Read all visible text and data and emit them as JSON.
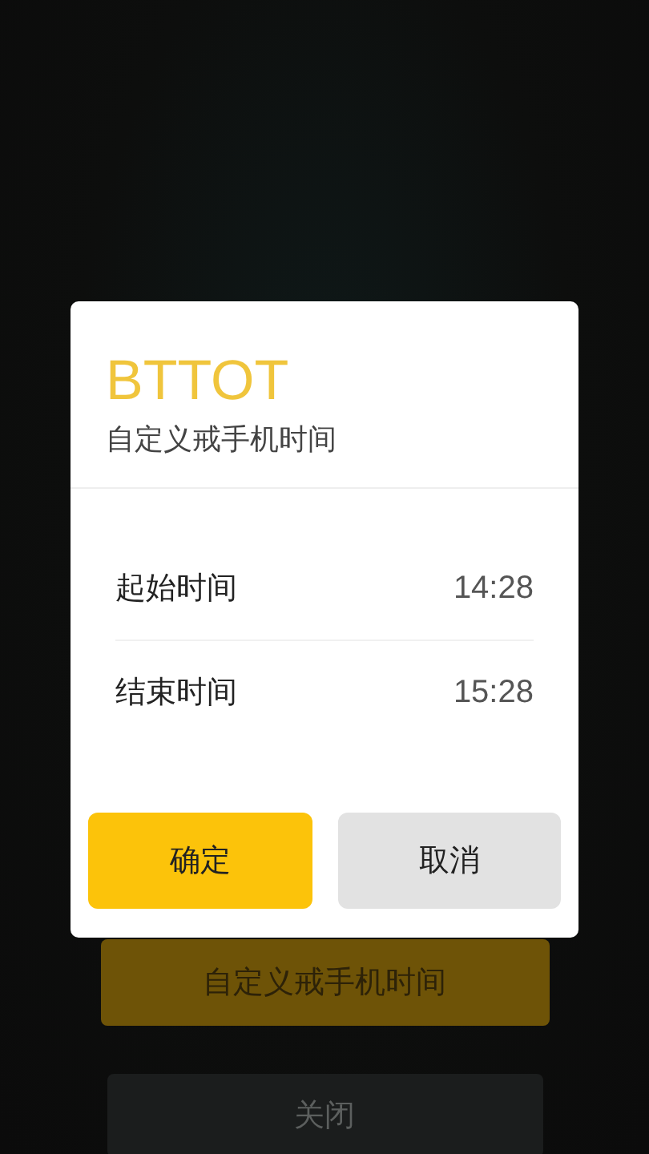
{
  "background_buttons": [
    {
      "label": "自定义戒手机时间",
      "kind": "primary"
    },
    {
      "label": "关闭",
      "kind": "secondary"
    }
  ],
  "dialog": {
    "title": "BTTOT",
    "subtitle": "自定义戒手机时间",
    "rows": [
      {
        "label": "起始时间",
        "value": "14:28"
      },
      {
        "label": "结束时间",
        "value": "15:28"
      }
    ],
    "buttons": [
      {
        "label": "确定",
        "kind": "primary"
      },
      {
        "label": "取消",
        "kind": "secondary"
      }
    ]
  }
}
